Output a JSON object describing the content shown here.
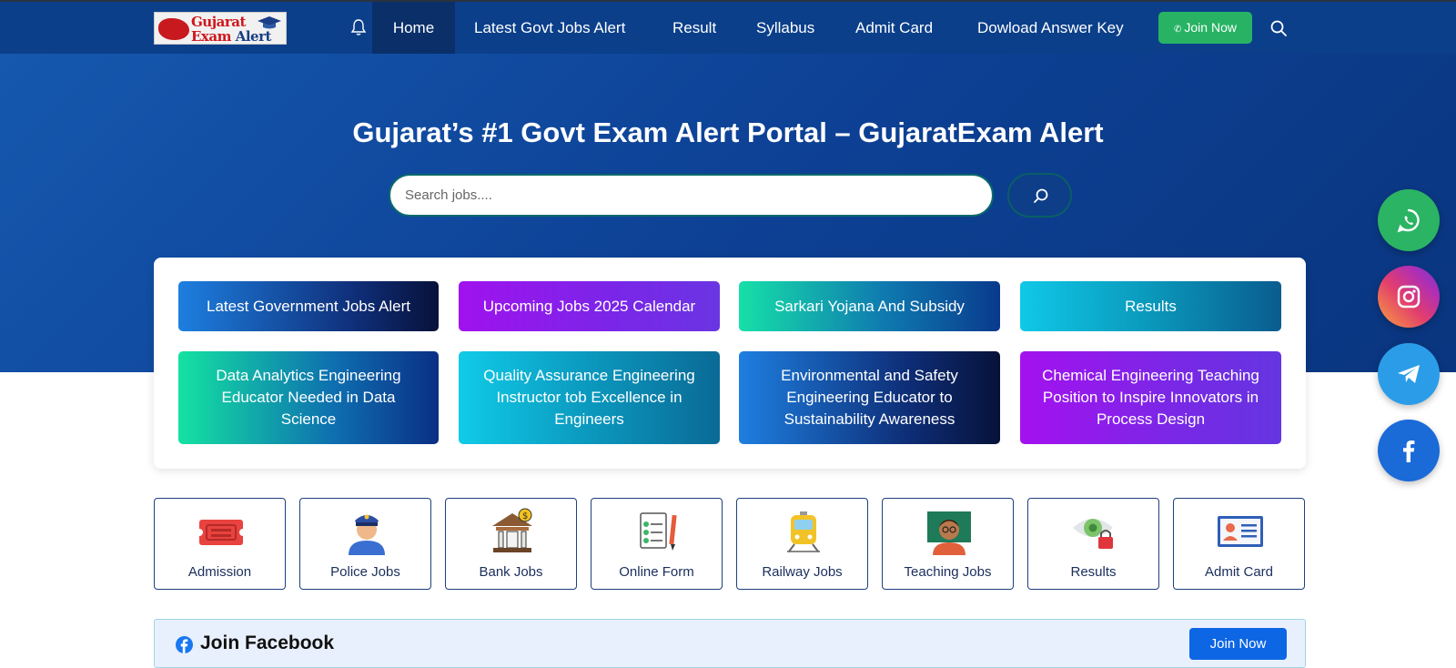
{
  "brand": {
    "logo_line1": "Gujarat",
    "logo_line2_word1": "Exam",
    "logo_line2_word2": "Alert"
  },
  "nav": {
    "items": [
      {
        "label": "Home",
        "active": true
      },
      {
        "label": "Latest Govt Jobs Alert"
      },
      {
        "label": "Result"
      },
      {
        "label": "Syllabus"
      },
      {
        "label": "Admit Card"
      },
      {
        "label": "Dowload Answer Key"
      }
    ],
    "join_label": "Join Now",
    "join_color": "#27b363"
  },
  "hero": {
    "title": "Gujarat’s #1 Govt Exam Alert Portal – GujaratExam Alert",
    "search_placeholder": "Search jobs...."
  },
  "quick_links": [
    {
      "label": "Latest Government Jobs Alert"
    },
    {
      "label": "Upcoming Jobs 2025 Calendar"
    },
    {
      "label": "Sarkari Yojana And Subsidy"
    },
    {
      "label": "Results"
    },
    {
      "label": "Data Analytics Engineering Educator Needed in Data Science"
    },
    {
      "label": "Quality Assurance Engineering Instructor tob Excellence in Engineers"
    },
    {
      "label": "Environmental and Safety Engineering Educator to Sustainability Awareness"
    },
    {
      "label": "Chemical Engineering Teaching Position to Inspire Innovators in Process Design"
    }
  ],
  "categories": [
    {
      "label": "Admission",
      "icon": "ticket-icon"
    },
    {
      "label": "Police Jobs",
      "icon": "police-officer-icon"
    },
    {
      "label": "Bank Jobs",
      "icon": "bank-icon"
    },
    {
      "label": "Online Form",
      "icon": "form-checklist-icon"
    },
    {
      "label": "Railway Jobs",
      "icon": "train-icon"
    },
    {
      "label": "Teaching Jobs",
      "icon": "teacher-icon"
    },
    {
      "label": "Results",
      "icon": "eye-lock-icon"
    },
    {
      "label": "Admit Card",
      "icon": "id-card-icon"
    }
  ],
  "facebook_bar": {
    "title": "Join Facebook",
    "button_label": "Join Now"
  },
  "social": [
    "whatsapp-icon",
    "instagram-icon",
    "telegram-icon",
    "facebook-icon"
  ],
  "colors": {
    "nav_bg": "#0b3f8a",
    "hero_bg": "#0d4195",
    "accent_blue": "#0d66e4"
  }
}
